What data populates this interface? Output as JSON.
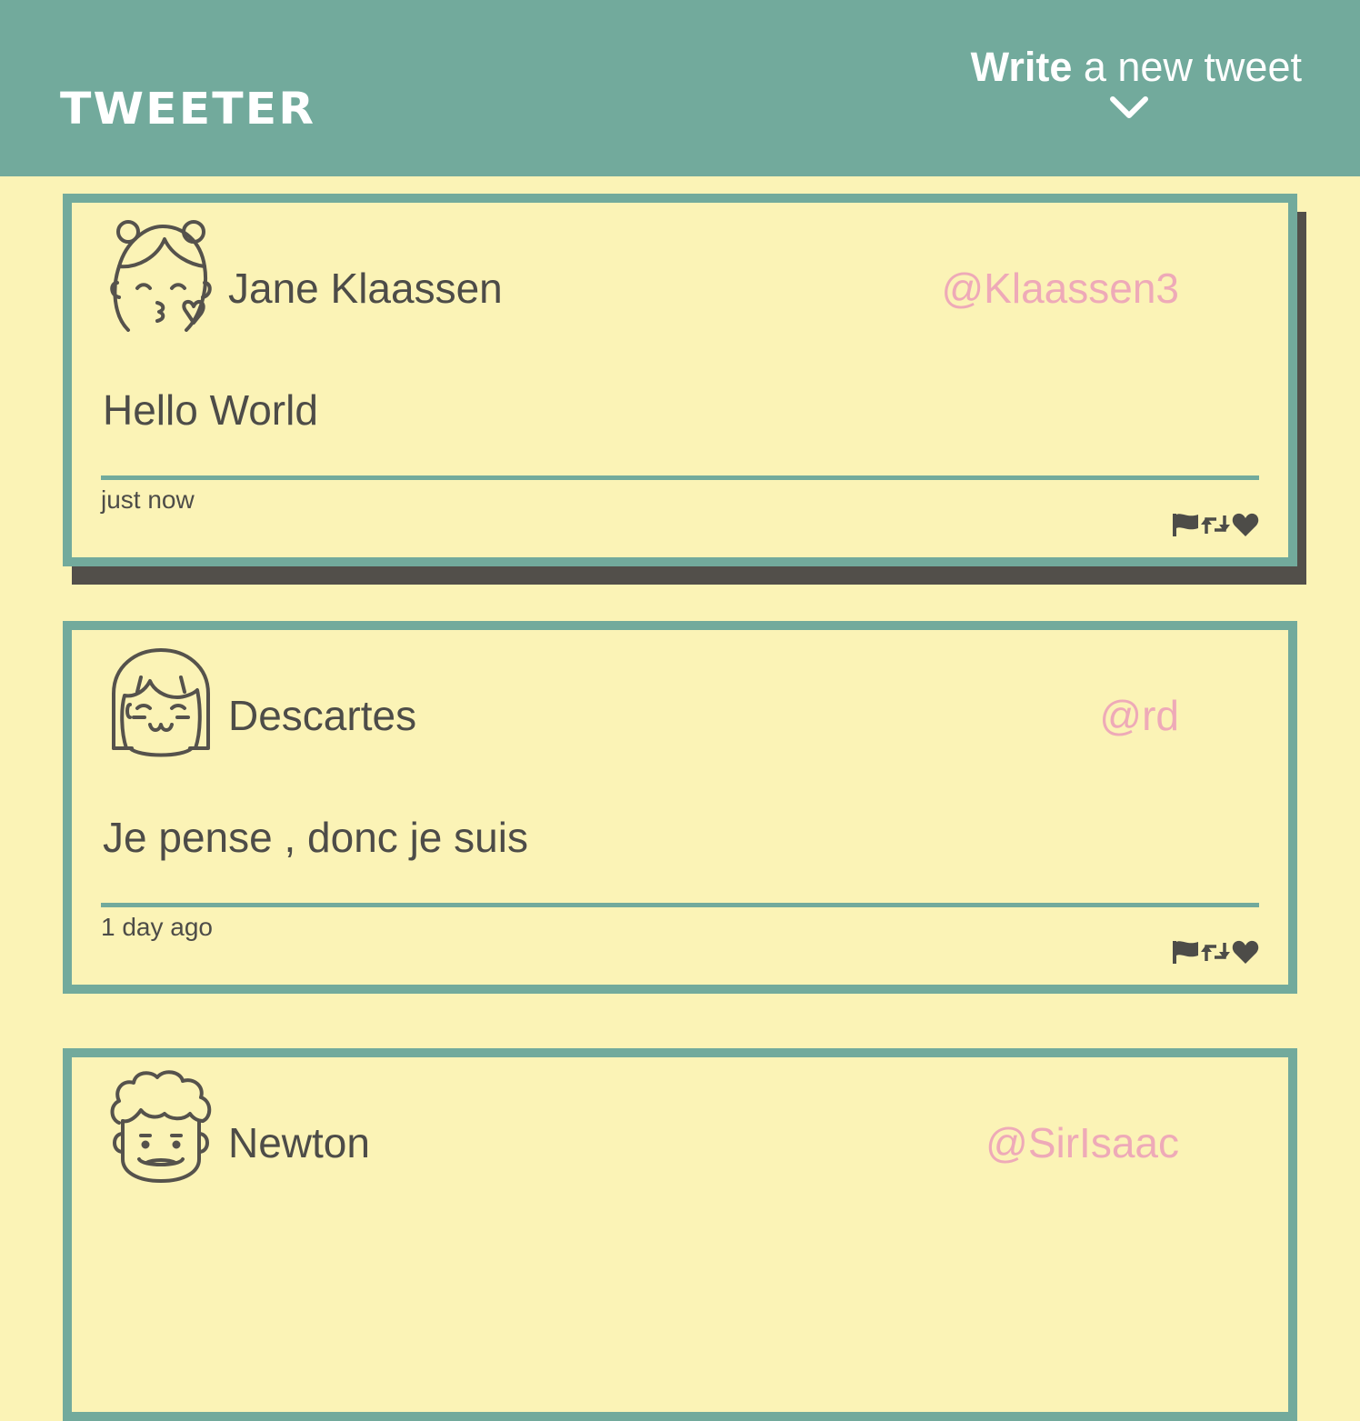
{
  "header": {
    "brand": "TWEETER",
    "compose_strong": "Write",
    "compose_rest": " a new tweet",
    "compose_icon": "chevron-down-icon"
  },
  "colors": {
    "background": "#fbf3b6",
    "accent": "#72aa9c",
    "text": "#4d4c48",
    "handle": "#eeaab8",
    "shadow": "#524f4a"
  },
  "tweets": [
    {
      "name": "Jane Klaassen",
      "handle": "@Klaassen3",
      "text": "Hello World",
      "time": "just now",
      "avatar_icon": "kissing-girl-avatar-icon",
      "actions": [
        "flag-icon",
        "retweet-icon",
        "heart-icon"
      ]
    },
    {
      "name": "Descartes",
      "handle": "@rd",
      "text": "Je pense , donc je suis",
      "time": "1 day ago",
      "avatar_icon": "smiling-girl-avatar-icon",
      "actions": [
        "flag-icon",
        "retweet-icon",
        "heart-icon"
      ]
    },
    {
      "name": "Newton",
      "handle": "@SirIsaac",
      "avatar_icon": "curly-hair-man-avatar-icon"
    }
  ]
}
